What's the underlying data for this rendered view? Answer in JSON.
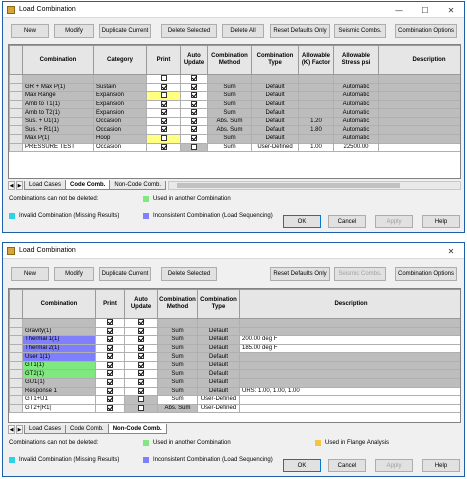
{
  "colors": {
    "used_in_another": "#7fe87f",
    "inconsistent": "#8080ff",
    "invalid": "#29d3e9",
    "flange": "#f5c542",
    "yellow_cell": "#ffff80",
    "gray_cell": "#bdbdbd"
  },
  "win1": {
    "title": "Load Combination",
    "toolbar": [
      "New",
      "Modify",
      "Duplicate Current",
      "Delete Selected",
      "Delete All",
      "Reset Defaults Only",
      "Seismic Combs.",
      "Combination Options"
    ],
    "headers": [
      "Combination",
      "Category",
      "Print",
      "Auto Update",
      "Combination Method",
      "Combination Type",
      "Allowable (K) Factor",
      "Allowable Stress psi",
      "Description"
    ],
    "rows": [
      {
        "combo": "",
        "category": "",
        "print": true,
        "auto": true,
        "method": "",
        "type": "",
        "factor": "",
        "stress": ""
      },
      {
        "combo": "GR + Max P(1)",
        "category": "Sustain",
        "print": true,
        "auto": true,
        "method": "Sum",
        "type": "Default",
        "factor": "",
        "stress": "Automatic"
      },
      {
        "combo": "Max Range",
        "category": "Expansion",
        "print": true,
        "auto": true,
        "method": "Sum",
        "type": "Default",
        "factor": "",
        "stress": "Automatic"
      },
      {
        "combo": "Amb to T1(1)",
        "category": "Expansion",
        "print": true,
        "auto": true,
        "method": "Sum",
        "type": "Default",
        "factor": "",
        "stress": "Automatic"
      },
      {
        "combo": "Amb to T2(1)",
        "category": "Expansion",
        "print": true,
        "auto": true,
        "method": "Sum",
        "type": "Default",
        "factor": "",
        "stress": "Automatic"
      },
      {
        "combo": "Sus. + U1(1)",
        "category": "Occasion",
        "print": true,
        "auto": true,
        "method": "Abs. Sum",
        "type": "Default",
        "factor": "1.20",
        "stress": "Automatic"
      },
      {
        "combo": "Sus. + R1(1)",
        "category": "Occasion",
        "print": true,
        "auto": true,
        "method": "Abs. Sum",
        "type": "Default",
        "factor": "1.80",
        "stress": "Automatic"
      },
      {
        "combo": "Max P(1)",
        "category": "Hoop",
        "print": true,
        "auto": true,
        "method": "Sum",
        "type": "Default",
        "factor": "",
        "stress": "Automatic"
      },
      {
        "combo": "PRESSURE TEST",
        "category": "Occasion",
        "print": true,
        "auto": false,
        "method": "Sum",
        "type": "User-Defined",
        "factor": "1.00",
        "stress": "22500.00"
      }
    ],
    "tabs": [
      "Load Cases",
      "Code Comb.",
      "Non-Code Comb."
    ],
    "active_tab": "Code Comb.",
    "legend": {
      "cannot_delete": "Combinations can not be deleted:",
      "used_in_another": "Used in another Combination",
      "invalid": "Invalid Combination (Missing Results)",
      "inconsistent": "Inconsistent Combination (Load Sequencing)"
    },
    "buttons": {
      "ok": "OK",
      "cancel": "Cancel",
      "apply": "Apply",
      "help": "Help"
    }
  },
  "win2": {
    "title": "Load Combination",
    "toolbar": [
      "New",
      "Modify",
      "Duplicate Current",
      "Delete Selected",
      "Reset Defaults Only",
      "Seismic Combs.",
      "Combination Options"
    ],
    "headers": [
      "Combination",
      "Print",
      "Auto Update",
      "Combination Method",
      "Combination Type",
      "Description"
    ],
    "rows": [
      {
        "combo": "",
        "print": true,
        "auto": true,
        "method": "",
        "type": "",
        "desc": ""
      },
      {
        "combo": "Gravity(1)",
        "print": true,
        "auto": true,
        "method": "Sum",
        "type": "Default",
        "desc": ""
      },
      {
        "combo": "Thermal 1(1)",
        "print": true,
        "auto": true,
        "method": "Sum",
        "type": "Default",
        "desc": "200.00 deg F"
      },
      {
        "combo": "Thermal 2(1)",
        "print": true,
        "auto": true,
        "method": "Sum",
        "type": "Default",
        "desc": "185.00 deg F"
      },
      {
        "combo": "User 1(1)",
        "print": true,
        "auto": true,
        "method": "Sum",
        "type": "Default",
        "desc": ""
      },
      {
        "combo": "GT1(1)",
        "print": true,
        "auto": true,
        "method": "Sum",
        "type": "Default",
        "desc": ""
      },
      {
        "combo": "GT2(1)",
        "print": true,
        "auto": true,
        "method": "Sum",
        "type": "Default",
        "desc": ""
      },
      {
        "combo": "GU1(1)",
        "print": true,
        "auto": true,
        "method": "Sum",
        "type": "Default",
        "desc": ""
      },
      {
        "combo": "Response 1",
        "print": true,
        "auto": true,
        "method": "Sum",
        "type": "Default",
        "desc": "URS: 1.00, 1.00, 1.00"
      },
      {
        "combo": "GT1+U1",
        "print": true,
        "auto": false,
        "method": "Sum",
        "type": "User-Defined",
        "desc": ""
      },
      {
        "combo": "GT2+|R1|",
        "print": true,
        "auto": false,
        "method": "Abs. Sum",
        "type": "User-Defined",
        "desc": ""
      }
    ],
    "tabs": [
      "Load Cases",
      "Code Comb.",
      "Non-Code Comb."
    ],
    "active_tab": "Non-Code Comb.",
    "legend": {
      "cannot_delete": "Combinations can not be deleted:",
      "used_in_another": "Used in another Combination",
      "flange": "Used in Flange Analysis",
      "invalid": "Invalid Combination (Missing Results)",
      "inconsistent": "Inconsistent Combination (Load Sequencing)"
    },
    "buttons": {
      "ok": "OK",
      "cancel": "Cancel",
      "apply": "Apply",
      "help": "Help"
    }
  }
}
